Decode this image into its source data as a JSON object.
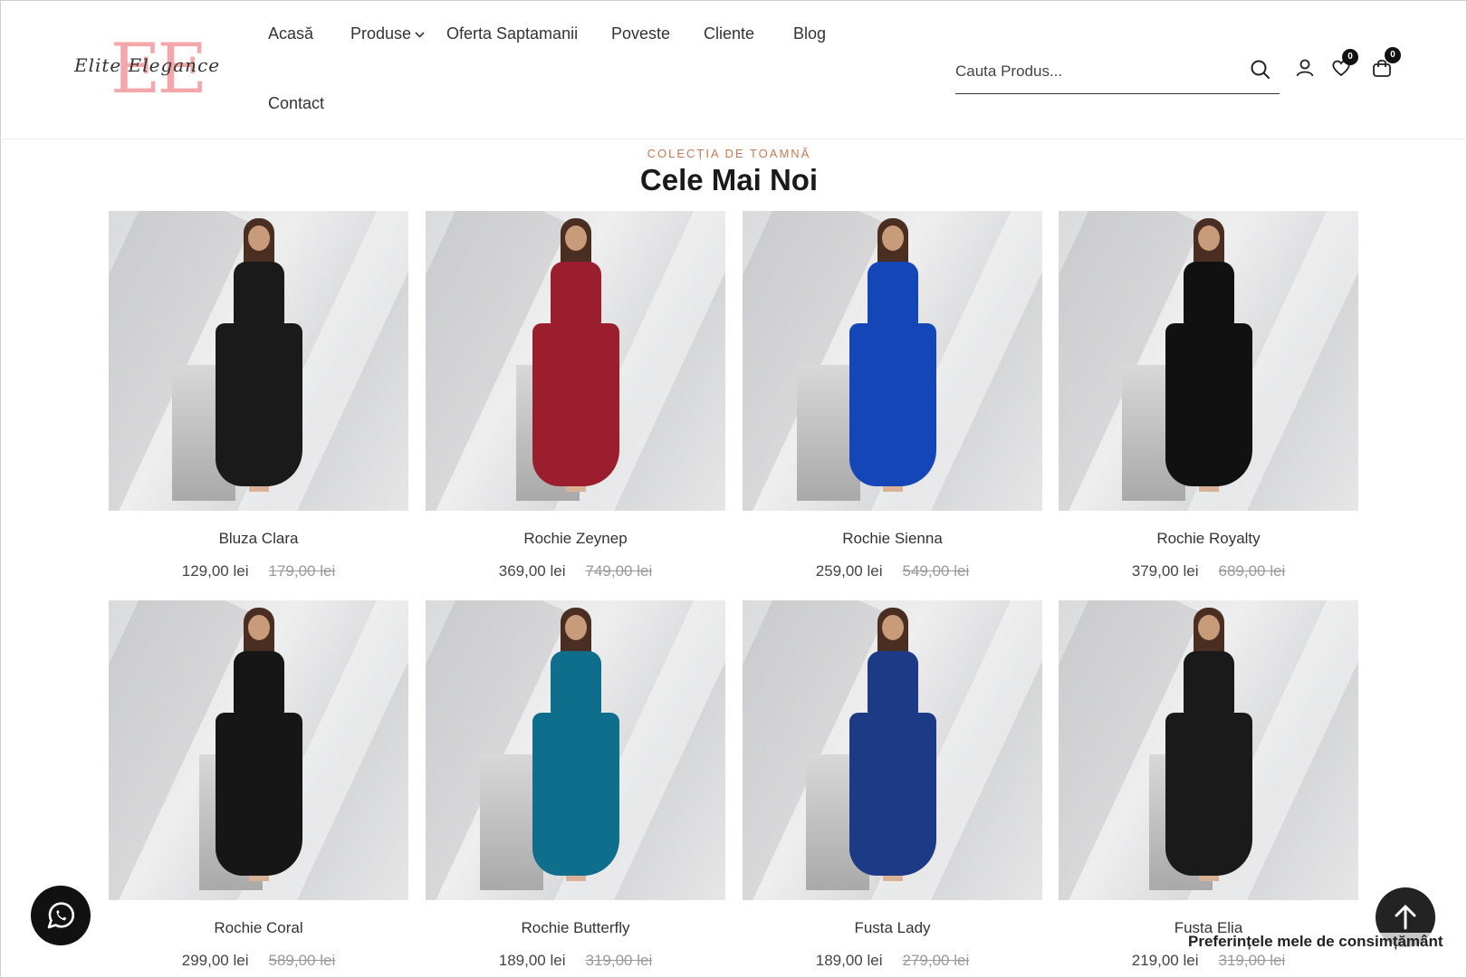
{
  "brand": {
    "logo_letters": "EE",
    "logo_script": "Elite Elegance"
  },
  "nav": {
    "items": [
      {
        "label": "Acasă"
      },
      {
        "label": "Produse"
      },
      {
        "label": "Oferta Saptamanii"
      },
      {
        "label": "Poveste"
      },
      {
        "label": "Cliente"
      },
      {
        "label": "Blog"
      },
      {
        "label": "Contact"
      }
    ]
  },
  "search": {
    "placeholder": "Cauta Produs..."
  },
  "header_icons": {
    "user": "user-icon",
    "wishlist": "heart-icon",
    "wishlist_count": "0",
    "cart": "bag-icon",
    "cart_count": "0"
  },
  "section": {
    "eyebrow": "COLECȚIA DE TOAMNĂ",
    "title": "Cele Mai Noi"
  },
  "products": [
    {
      "name": "Bluza Clara",
      "price": "129,00 lei",
      "old_price": "179,00 lei",
      "dress_color": "#1a1a1a"
    },
    {
      "name": "Rochie Zeynep",
      "price": "369,00 lei",
      "old_price": "749,00 lei",
      "dress_color": "#9b1e2e"
    },
    {
      "name": "Rochie Sienna",
      "price": "259,00 lei",
      "old_price": "549,00 lei",
      "dress_color": "#1546b8"
    },
    {
      "name": "Rochie Royalty",
      "price": "379,00 lei",
      "old_price": "689,00 lei",
      "dress_color": "#111111"
    },
    {
      "name": "Rochie Coral",
      "price": "299,00 lei",
      "old_price": "589,00 lei",
      "dress_color": "#161616"
    },
    {
      "name": "Rochie Butterfly",
      "price": "189,00 lei",
      "old_price": "319,00 lei",
      "dress_color": "#0f6e8c"
    },
    {
      "name": "Fusta Lady",
      "price": "189,00 lei",
      "old_price": "279,00 lei",
      "dress_color": "#1c3a86"
    },
    {
      "name": "Fusta Elia",
      "price": "219,00 lei",
      "old_price": "319,00 lei",
      "dress_color": "#1a1a1a"
    }
  ],
  "floating": {
    "whatsapp": "whatsapp-icon",
    "scroll_top": "arrow-up-icon",
    "consent": "Preferințele mele de consimțământ"
  }
}
